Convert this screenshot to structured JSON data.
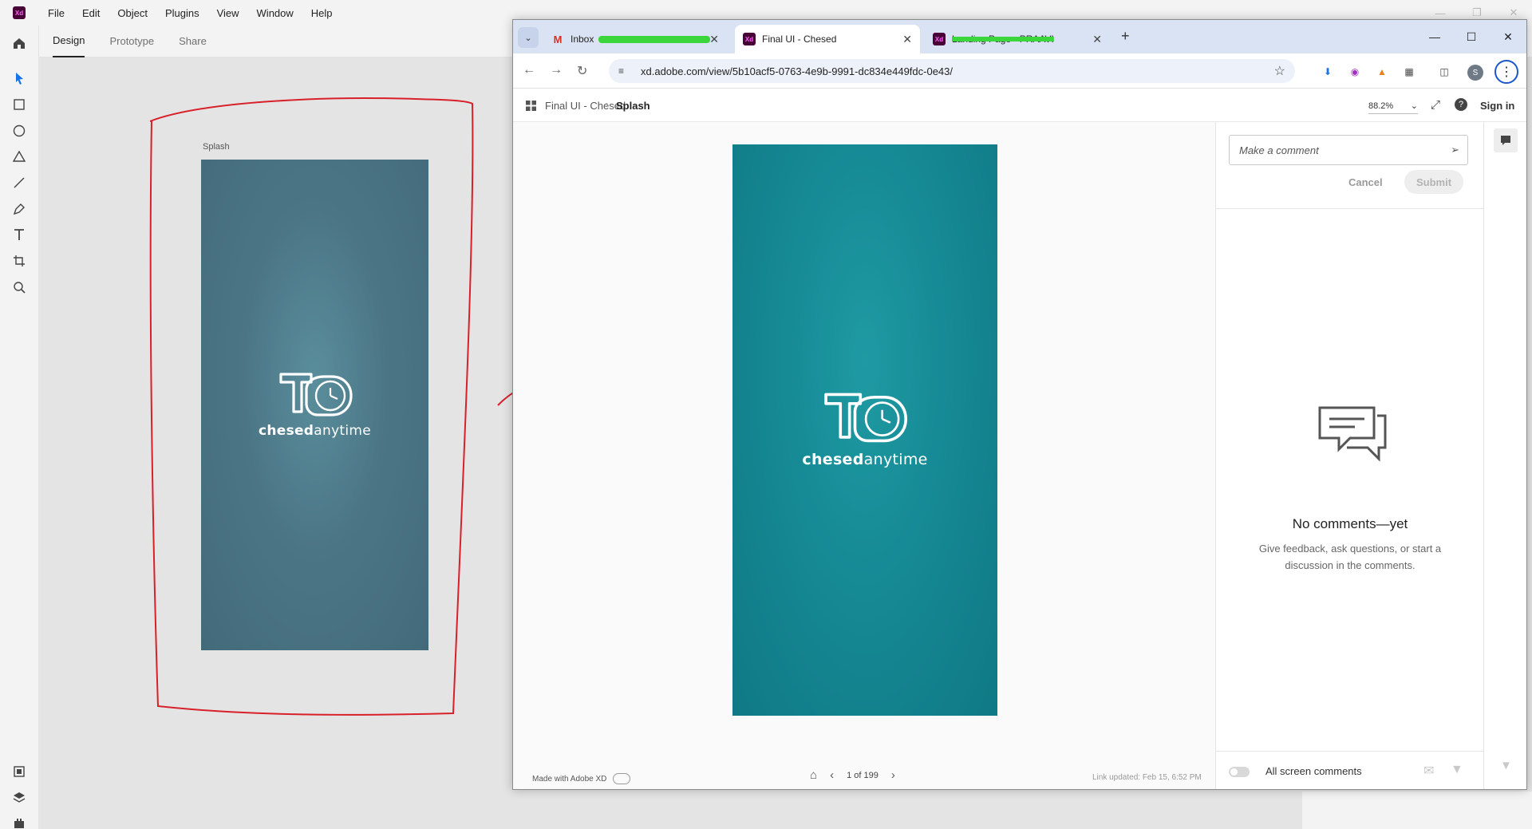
{
  "xd": {
    "menu": [
      "File",
      "Edit",
      "Object",
      "Plugins",
      "View",
      "Window",
      "Help"
    ],
    "tabs": [
      "Design",
      "Prototype",
      "Share"
    ],
    "artboard_label": "Splash",
    "brand_bold": "chesed",
    "brand_light": "anytime"
  },
  "browser": {
    "tabs": [
      {
        "title": "Inbox",
        "favicon": "gmail-icon"
      },
      {
        "title": "Final UI - Chesed",
        "favicon": "xd-icon"
      },
      {
        "title": "Landing Page - PRAAVI",
        "favicon": "xd-icon"
      }
    ],
    "url": "xd.adobe.com/view/5b10acf5-0763-4e9b-9991-dc834e449fdc-0e43/",
    "profile_initial": "S"
  },
  "viewer": {
    "breadcrumb_project": "Final UI - Chesed",
    "breadcrumb_screen": "Splash",
    "zoom": "88.2%",
    "sign_in": "Sign in",
    "brand_bold": "chesed",
    "brand_light": "anytime",
    "made_with": "Made with Adobe XD",
    "page_indicator": "1 of 199",
    "link_updated": "Link updated: Feb 15, 6:52 PM"
  },
  "comments": {
    "placeholder": "Make a comment",
    "cancel": "Cancel",
    "submit": "Submit",
    "empty_title": "No comments—yet",
    "empty_subtitle": "Give feedback, ask questions, or start a discussion in the comments.",
    "all_screen": "All screen comments"
  },
  "colors": {
    "annotation_red": "#d8202a",
    "teal": "#168b96",
    "slate": "#4b7585",
    "link_blue": "#1a57c9"
  }
}
